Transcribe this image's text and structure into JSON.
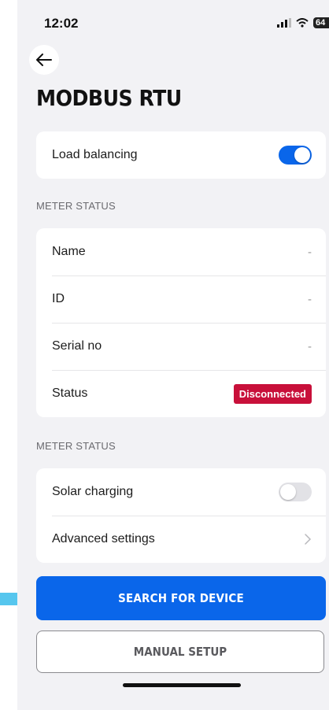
{
  "status_bar": {
    "time": "12:02",
    "battery": "64"
  },
  "header": {
    "title": "MODBUS RTU"
  },
  "load_balancing": {
    "label": "Load balancing",
    "enabled": true
  },
  "meter_status_section": {
    "heading": "METER STATUS",
    "rows": [
      {
        "label": "Name",
        "value": "-"
      },
      {
        "label": "ID",
        "value": "-"
      },
      {
        "label": "Serial no",
        "value": "-"
      }
    ],
    "status": {
      "label": "Status",
      "badge": "Disconnected",
      "badge_color": "#c8103a"
    }
  },
  "settings_section": {
    "heading": "METER STATUS",
    "solar_charging": {
      "label": "Solar charging",
      "enabled": false
    },
    "advanced": {
      "label": "Advanced settings"
    }
  },
  "actions": {
    "search_label": "SEARCH FOR DEVICE",
    "manual_label": "MANUAL SETUP"
  },
  "colors": {
    "accent": "#0a66ea",
    "pointer": "#56c6ee",
    "danger": "#c8103a"
  },
  "icons": {
    "back": "arrow-left-icon",
    "chevron": "chevron-right-icon",
    "pointer": "arrow-right-icon"
  }
}
